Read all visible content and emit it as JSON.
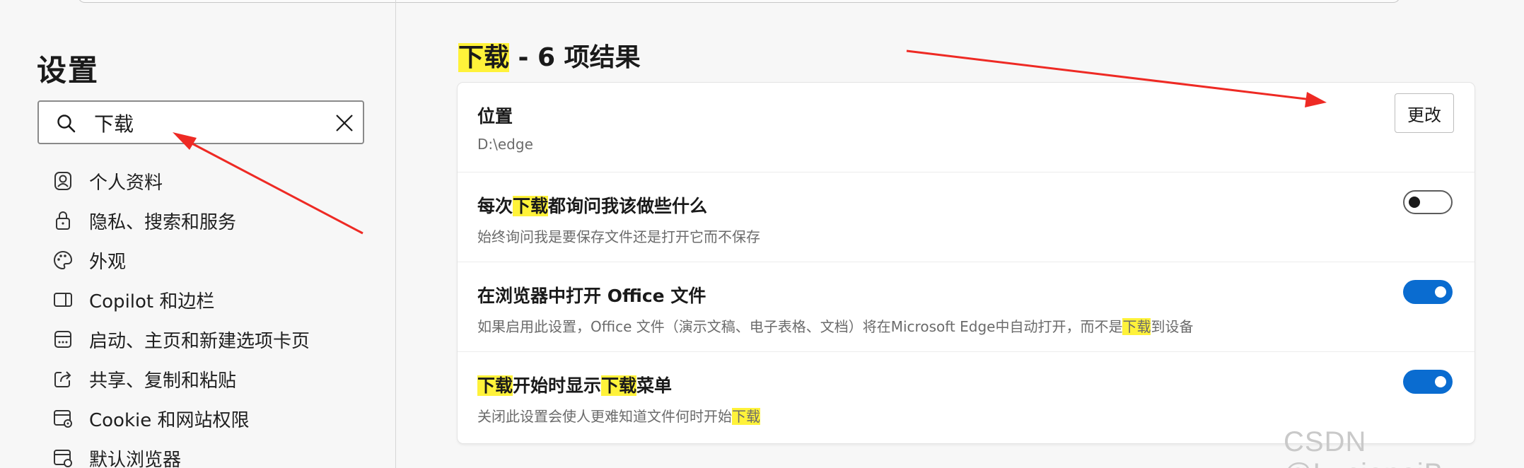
{
  "sidebar": {
    "title": "设置",
    "search": {
      "value": "下载",
      "placeholder": ""
    },
    "items": [
      {
        "label": "个人资料",
        "icon": "profile-icon"
      },
      {
        "label": "隐私、搜索和服务",
        "icon": "lock-icon"
      },
      {
        "label": "外观",
        "icon": "palette-icon"
      },
      {
        "label": "Copilot 和边栏",
        "icon": "sidebar-icon"
      },
      {
        "label": "启动、主页和新建选项卡页",
        "icon": "startup-icon"
      },
      {
        "label": "共享、复制和粘贴",
        "icon": "share-icon"
      },
      {
        "label": "Cookie 和网站权限",
        "icon": "cookie-site-icon"
      },
      {
        "label": "默认浏览器",
        "icon": "default-browser-icon"
      }
    ]
  },
  "main": {
    "title_highlight": "下载",
    "title_rest": " - 6 项结果",
    "settings": [
      {
        "title": [
          {
            "t": "位置",
            "hl": false
          }
        ],
        "desc": [
          {
            "t": "D:\\edge",
            "hl": false
          }
        ],
        "control": "button",
        "button_label": "更改"
      },
      {
        "title": [
          {
            "t": "每次",
            "hl": false
          },
          {
            "t": "下载",
            "hl": true
          },
          {
            "t": "都询问我该做些什么",
            "hl": false
          }
        ],
        "desc": [
          {
            "t": "始终询问我是要保存文件还是打开它而不保存",
            "hl": false
          }
        ],
        "control": "toggle",
        "on": false
      },
      {
        "title": [
          {
            "t": "在浏览器中打开 Office 文件",
            "hl": false
          }
        ],
        "desc": [
          {
            "t": "如果启用此设置，Office 文件（演示文稿、电子表格、文档）将在Microsoft Edge中自动打开，而不是",
            "hl": false
          },
          {
            "t": "下载",
            "hl": true
          },
          {
            "t": "到设备",
            "hl": false
          }
        ],
        "control": "toggle",
        "on": true
      },
      {
        "title": [
          {
            "t": "下载",
            "hl": true
          },
          {
            "t": "开始时显示",
            "hl": false
          },
          {
            "t": "下载",
            "hl": true
          },
          {
            "t": "菜单",
            "hl": false
          }
        ],
        "desc": [
          {
            "t": "关闭此设置会使人更难知道文件何时开始",
            "hl": false
          },
          {
            "t": "下载",
            "hl": true
          }
        ],
        "control": "toggle",
        "on": true
      }
    ]
  },
  "watermark": "CSDN @LucianaiB",
  "colors": {
    "accent": "#0a6cd0",
    "highlight": "#fff23a",
    "arrow": "#ee2a24"
  }
}
